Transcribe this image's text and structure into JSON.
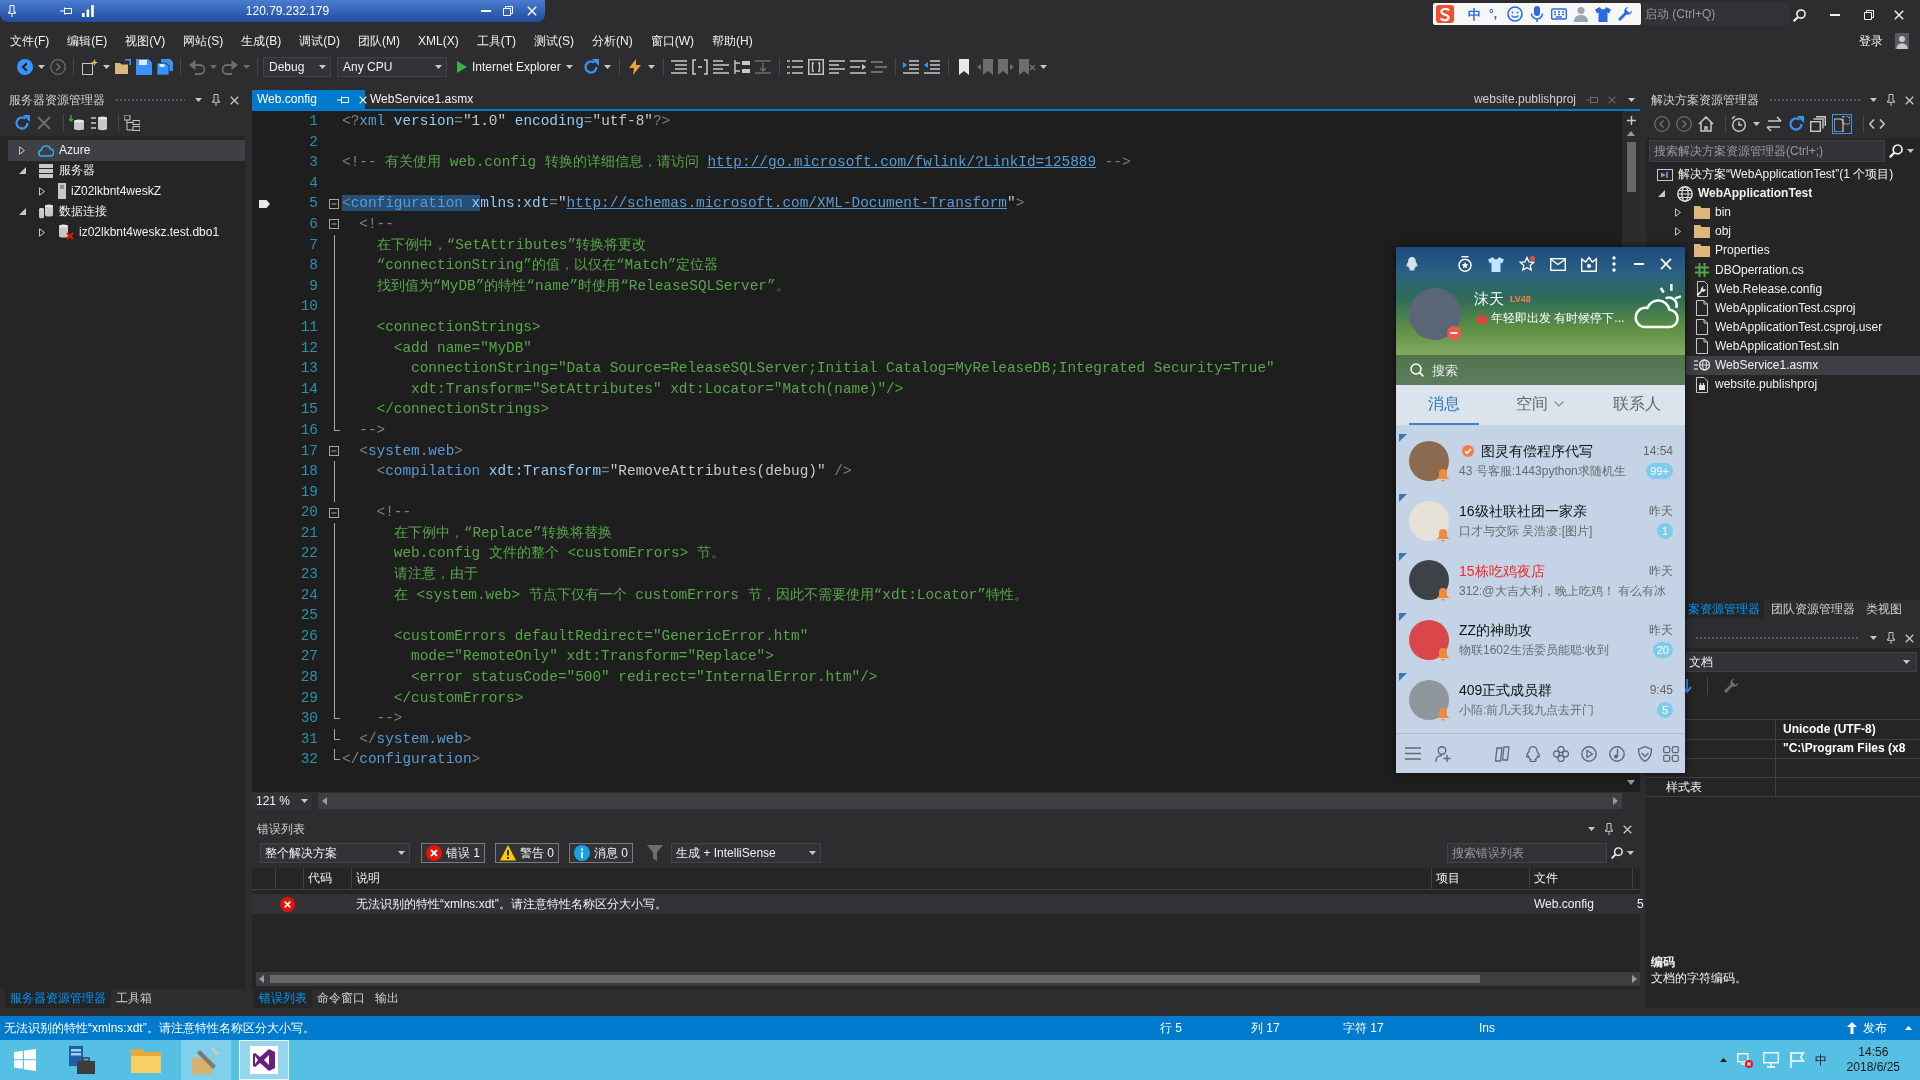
{
  "title_bar": {
    "remote_address": "120.79.232.179",
    "ime_mode": "中",
    "ime_punctuation": "°,",
    "quick_launch": {
      "placeholder": "启动 (Ctrl+Q)"
    }
  },
  "menu": [
    "文件(F)",
    "编辑(E)",
    "视图(V)",
    "网站(S)",
    "生成(B)",
    "调试(D)",
    "团队(M)",
    "XML(X)",
    "工具(T)",
    "测试(S)",
    "分析(N)",
    "窗口(W)",
    "帮助(H)"
  ],
  "account": {
    "label": "登录"
  },
  "toolbar": {
    "configuration": "Debug",
    "platform": "Any CPU",
    "run_target": "Internet Explorer"
  },
  "server_explorer": {
    "title": "服务器资源管理器",
    "tree": [
      {
        "label": "Azure",
        "kind": "cloud",
        "expanded": false,
        "selected": true
      },
      {
        "label": "服务器",
        "kind": "servers",
        "expanded": true,
        "selected": false,
        "children": [
          {
            "label": "iZ02lkbnt4weskZ",
            "kind": "server",
            "expanded": false,
            "selected": false
          }
        ]
      },
      {
        "label": "数据连接",
        "kind": "connections",
        "expanded": true,
        "selected": false,
        "children": [
          {
            "label": "iz02lkbnt4weskz.test.dbo1",
            "kind": "database-error",
            "expanded": false,
            "selected": false
          }
        ]
      }
    ]
  },
  "left_tabs": [
    {
      "label": "服务器资源管理器",
      "selected": true
    },
    {
      "label": "工具箱",
      "selected": false
    }
  ],
  "editor": {
    "tabs": [
      {
        "label": "Web.config",
        "selected": true
      },
      {
        "label": "WebService1.asmx",
        "selected": false
      }
    ],
    "preview_tab": {
      "label": "website.publishproj"
    },
    "zoom": "121 %",
    "lines": [
      {
        "num": "1",
        "kind": "plain",
        "tokens": [
          {
            "kind": "delim",
            "text": "<?"
          },
          {
            "kind": "name",
            "text": "xml"
          },
          {
            "kind": "attr",
            "text": " version"
          },
          {
            "kind": "delim",
            "text": "="
          },
          {
            "kind": "value",
            "text": "\"1.0\""
          },
          {
            "kind": "attr",
            "text": " encoding"
          },
          {
            "kind": "delim",
            "text": "="
          },
          {
            "kind": "value",
            "text": "\"utf-8\""
          },
          {
            "kind": "delim",
            "text": "?>"
          }
        ]
      },
      {
        "num": "2",
        "kind": "plain"
      },
      {
        "num": "3",
        "kind": "plain",
        "tokens": [
          {
            "kind": "delim",
            "text": "<!--"
          },
          {
            "kind": "comment",
            "text": " 有关使用 web.config 转换的详细信息，请访问 "
          },
          {
            "kind": "link",
            "text": "http://go.microsoft.com/fwlink/?LinkId=125889"
          },
          {
            "kind": "delim",
            "text": " -->"
          }
        ]
      },
      {
        "num": "4",
        "kind": "plain"
      },
      {
        "num": "5",
        "kind": "open",
        "selected_tokens": [
          {
            "kind": "delim",
            "text": "<"
          },
          {
            "kind": "name",
            "text": "configuration"
          },
          {
            "kind": "attr",
            "text": " x"
          }
        ],
        "tokens": [
          {
            "kind": "attr",
            "text": "mlns:xdt"
          },
          {
            "kind": "delim",
            "text": "="
          },
          {
            "kind": "value",
            "text": "\""
          },
          {
            "kind": "link",
            "text": "http://schemas.microsoft.com/XML-Document-Transform"
          },
          {
            "kind": "value",
            "text": "\""
          },
          {
            "kind": "delim",
            "text": ">"
          }
        ]
      },
      {
        "num": "6",
        "kind": "open",
        "tokens": [
          {
            "kind": "delim",
            "text": "  <!--"
          }
        ]
      },
      {
        "num": "7",
        "kind": "inside",
        "tokens": [
          {
            "kind": "comment",
            "text": "    在下例中，“SetAttributes”转换将更改"
          }
        ]
      },
      {
        "num": "8",
        "kind": "inside",
        "tokens": [
          {
            "kind": "comment",
            "text": "    “connectionString”的值，以仅在“Match”定位器"
          }
        ]
      },
      {
        "num": "9",
        "kind": "inside",
        "tokens": [
          {
            "kind": "comment",
            "text": "    找到值为“MyDB”的特性“name”时使用“ReleaseSQLServer”。"
          }
        ]
      },
      {
        "num": "10",
        "kind": "inside"
      },
      {
        "num": "11",
        "kind": "inside",
        "tokens": [
          {
            "kind": "comment",
            "text": "    <connectionStrings>"
          }
        ]
      },
      {
        "num": "12",
        "kind": "inside",
        "tokens": [
          {
            "kind": "comment",
            "text": "      <add name=\"MyDB\""
          }
        ]
      },
      {
        "num": "13",
        "kind": "inside",
        "tokens": [
          {
            "kind": "comment",
            "text": "        connectionString=\"Data Source=ReleaseSQLServer;Initial Catalog=MyReleaseDB;Integrated Security=True\""
          }
        ]
      },
      {
        "num": "14",
        "kind": "inside",
        "tokens": [
          {
            "kind": "comment",
            "text": "        xdt:Transform=\"SetAttributes\" xdt:Locator=\"Match(name)\"/>"
          }
        ]
      },
      {
        "num": "15",
        "kind": "inside",
        "tokens": [
          {
            "kind": "comment",
            "text": "    </connectionStrings>"
          }
        ]
      },
      {
        "num": "16",
        "kind": "close",
        "tokens": [
          {
            "kind": "delim",
            "text": "  -->"
          }
        ]
      },
      {
        "num": "17",
        "kind": "open",
        "tokens": [
          {
            "kind": "delim",
            "text": "  <"
          },
          {
            "kind": "name",
            "text": "system.web"
          },
          {
            "kind": "delim",
            "text": ">"
          }
        ]
      },
      {
        "num": "18",
        "kind": "inside",
        "tokens": [
          {
            "kind": "delim",
            "text": "    <"
          },
          {
            "kind": "name",
            "text": "compilation"
          },
          {
            "kind": "attr",
            "text": " xdt:Transform"
          },
          {
            "kind": "delim",
            "text": "="
          },
          {
            "kind": "value",
            "text": "\"RemoveAttributes(debug)\""
          },
          {
            "kind": "delim",
            "text": " />"
          }
        ]
      },
      {
        "num": "19",
        "kind": "inside"
      },
      {
        "num": "20",
        "kind": "open",
        "tokens": [
          {
            "kind": "delim",
            "text": "    <!--"
          }
        ]
      },
      {
        "num": "21",
        "kind": "inside",
        "tokens": [
          {
            "kind": "comment",
            "text": "      在下例中，“Replace”转换将替换"
          }
        ]
      },
      {
        "num": "22",
        "kind": "inside",
        "tokens": [
          {
            "kind": "comment",
            "text": "      web.config 文件的整个 <customErrors> 节。"
          }
        ]
      },
      {
        "num": "23",
        "kind": "inside",
        "tokens": [
          {
            "kind": "comment",
            "text": "      请注意，由于"
          }
        ]
      },
      {
        "num": "24",
        "kind": "inside",
        "tokens": [
          {
            "kind": "comment",
            "text": "      在 <system.web> 节点下仅有一个 customErrors 节，因此不需要使用“xdt:Locator”特性。"
          }
        ]
      },
      {
        "num": "25",
        "kind": "inside"
      },
      {
        "num": "26",
        "kind": "inside",
        "tokens": [
          {
            "kind": "comment",
            "text": "      <customErrors defaultRedirect=\"GenericError.htm\""
          }
        ]
      },
      {
        "num": "27",
        "kind": "inside",
        "tokens": [
          {
            "kind": "comment",
            "text": "        mode=\"RemoteOnly\" xdt:Transform=\"Replace\">"
          }
        ]
      },
      {
        "num": "28",
        "kind": "inside",
        "tokens": [
          {
            "kind": "comment",
            "text": "        <error statusCode=\"500\" redirect=\"InternalError.htm\"/>"
          }
        ]
      },
      {
        "num": "29",
        "kind": "inside",
        "tokens": [
          {
            "kind": "comment",
            "text": "      </customErrors>"
          }
        ]
      },
      {
        "num": "30",
        "kind": "close",
        "tokens": [
          {
            "kind": "delim",
            "text": "    -->"
          }
        ]
      },
      {
        "num": "31",
        "kind": "close",
        "tokens": [
          {
            "kind": "delim",
            "text": "  </"
          },
          {
            "kind": "name",
            "text": "system.web"
          },
          {
            "kind": "delim",
            "text": ">"
          }
        ]
      },
      {
        "num": "32",
        "kind": "close",
        "tokens": [
          {
            "kind": "delim",
            "text": "</"
          },
          {
            "kind": "name",
            "text": "configuration"
          },
          {
            "kind": "delim",
            "text": ">"
          }
        ]
      }
    ]
  },
  "error_list": {
    "title": "错误列表",
    "scope": "整个解决方案",
    "filters": [
      {
        "kind": "error",
        "label": "错误 1",
        "selected": true
      },
      {
        "kind": "warning",
        "label": "警告 0",
        "selected": true
      },
      {
        "kind": "message",
        "label": "消息 0",
        "selected": true
      }
    ],
    "source": "生成 + IntelliSense",
    "search": {
      "placeholder": "搜索错误列表"
    },
    "columns": [
      "代码",
      "说明",
      "项目",
      "文件"
    ],
    "rows": [
      {
        "kind": "error",
        "description": "无法识别的特性“xmlns:xdt”。请注意特性名称区分大小写。",
        "file": "Web.config",
        "line": "5"
      }
    ]
  },
  "panel_tabs": [
    {
      "label": "错误列表",
      "selected": true
    },
    {
      "label": "命令窗口",
      "selected": false
    },
    {
      "label": "输出",
      "selected": false
    }
  ],
  "solution_explorer": {
    "title": "解决方案资源管理器",
    "show_all_files": true,
    "search": {
      "placeholder": "搜索解决方案资源管理器(Ctrl+;)"
    },
    "tree": [
      {
        "label": "解决方案“WebApplicationTest”(1 个项目)",
        "kind": "solution",
        "selected": false,
        "children": [
          {
            "label": "WebApplicationTest",
            "kind": "project",
            "expanded": true,
            "selected": false,
            "children": [
              {
                "label": "bin",
                "kind": "folder",
                "expanded": false,
                "selected": false
              },
              {
                "label": "obj",
                "kind": "folder",
                "expanded": false,
                "selected": false
              },
              {
                "label": "Properties",
                "kind": "folder",
                "selected": false
              },
              {
                "label": "DBOperration.cs",
                "kind": "code",
                "selected": false
              },
              {
                "label": "Web.Release.config",
                "kind": "config",
                "selected": false
              },
              {
                "label": "WebApplicationTest.csproj",
                "kind": "file",
                "selected": false
              },
              {
                "label": "WebApplicationTest.csproj.user",
                "kind": "file",
                "selected": false
              },
              {
                "label": "WebApplicationTest.sln",
                "kind": "file",
                "selected": false
              },
              {
                "label": "WebService1.asmx",
                "kind": "service",
                "selected": true
              },
              {
                "label": "website.publishproj",
                "kind": "publish",
                "selected": false
              }
            ]
          }
        ]
      }
    ]
  },
  "right_tabs": [
    {
      "label": "案资源管理器",
      "selected": true
    },
    {
      "label": "团队资源管理器",
      "selected": false
    },
    {
      "label": "类视图",
      "selected": false
    }
  ],
  "properties": {
    "object": "文档",
    "rows": [
      {
        "kind": "category"
      },
      {
        "kind": "property",
        "value": "Unicode (UTF-8)"
      },
      {
        "kind": "property",
        "value": "\"C:\\Program Files (x8"
      },
      {
        "kind": "property"
      },
      {
        "kind": "property",
        "name": "样式表"
      }
    ],
    "description": {
      "title": "编码",
      "text": "文档的字符编码。"
    }
  },
  "status_bar": {
    "message": "无法识别的特性“xmlns:xdt”。请注意特性名称区分大小写。",
    "line": "行 5",
    "column": "列 17",
    "character": "字符 17",
    "mode": "Ins",
    "publish": "发布"
  },
  "taskbar": {
    "apps": [
      {
        "kind": "server-manager",
        "running": false,
        "focused": false
      },
      {
        "kind": "explorer",
        "running": false,
        "focused": false
      },
      {
        "kind": "tools",
        "running": true,
        "focused": false
      },
      {
        "kind": "visual-studio",
        "running": true,
        "focused": true
      }
    ],
    "ime": "中",
    "time": "14:56",
    "date": "2018/6/25"
  },
  "qq": {
    "profile": {
      "name": "沫天",
      "level": "LV48",
      "signature": "年轻即出发 有时候停下...",
      "busy": true
    },
    "search": {
      "placeholder": "搜索"
    },
    "tabs": [
      {
        "label": "消息",
        "selected": true,
        "dropdown": false
      },
      {
        "label": "空间",
        "selected": false,
        "dropdown": true
      },
      {
        "label": "联系人",
        "selected": false,
        "dropdown": false
      }
    ],
    "chats": [
      {
        "name": "图灵有偿程序代写",
        "color": "#111111",
        "verified": true,
        "time": "14:54",
        "preview": "43 号客服:1443python求随机生",
        "unread": "99+",
        "pinned": true,
        "muted": true
      },
      {
        "name": "16级社联社团一家亲",
        "color": "#111111",
        "verified": false,
        "time": "昨天",
        "preview": "口才与交际 吴浩凌:[图片]",
        "unread": "1",
        "pinned": true,
        "muted": true
      },
      {
        "name": "15栋吃鸡夜店",
        "color": "#ee2b2b",
        "verified": false,
        "time": "昨天",
        "preview": "312:@大吉大利，晚上吃鸡！ 有么有冰",
        "pinned": true,
        "muted": true
      },
      {
        "name": "ZZ的神助攻",
        "color": "#111111",
        "verified": false,
        "time": "昨天",
        "preview": "物联1602生活委员能聪:收到",
        "unread": "20",
        "pinned": true,
        "muted": true
      },
      {
        "name": "409正式成员群",
        "color": "#111111",
        "verified": false,
        "time": "9:45",
        "preview": "小陌:前几天我九点去开门",
        "unread": "5",
        "pinned": true,
        "muted": true
      }
    ]
  }
}
